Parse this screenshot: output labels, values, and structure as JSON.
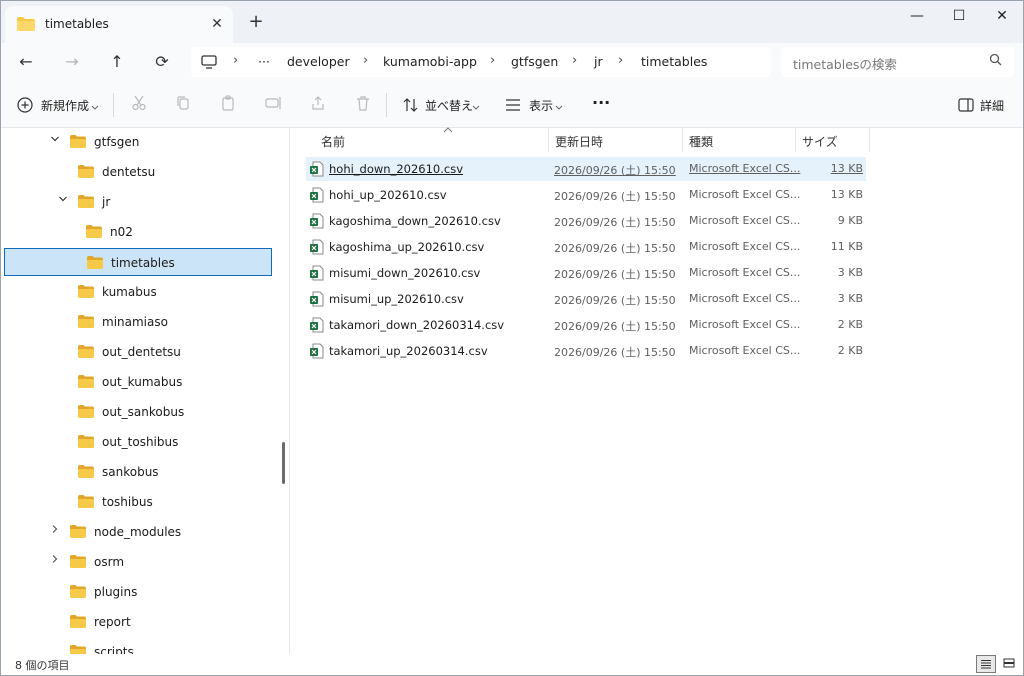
{
  "window": {
    "tab_title": "timetables",
    "tab_close": "✕",
    "new_tab": "+",
    "min": "—",
    "max": "☐",
    "close": "✕"
  },
  "nav": {
    "back": "←",
    "forward": "→",
    "up": "↑",
    "refresh": "⟳",
    "breadcrumb": [
      "developer",
      "kumamobi-app",
      "gtfsgen",
      "jr",
      "timetables"
    ],
    "breadcrumb_sep": "›",
    "overflow": "···",
    "search_placeholder": "timetablesの検索"
  },
  "commands": {
    "new": "新規作成",
    "sort": "並べ替え",
    "view": "表示",
    "more": "···",
    "details": "詳細"
  },
  "sidebar": {
    "items": [
      {
        "label": "gtfsgen",
        "level": 1,
        "chevron": "expanded"
      },
      {
        "label": "dentetsu",
        "level": 2,
        "chevron": "none"
      },
      {
        "label": "jr",
        "level": 2,
        "chevron": "expanded"
      },
      {
        "label": "n02",
        "level": 3,
        "chevron": "none"
      },
      {
        "label": "timetables",
        "level": 3,
        "chevron": "none",
        "selected": true
      },
      {
        "label": "kumabus",
        "level": 2,
        "chevron": "none"
      },
      {
        "label": "minamiaso",
        "level": 2,
        "chevron": "none"
      },
      {
        "label": "out_dentetsu",
        "level": 2,
        "chevron": "none"
      },
      {
        "label": "out_kumabus",
        "level": 2,
        "chevron": "none"
      },
      {
        "label": "out_sankobus",
        "level": 2,
        "chevron": "none"
      },
      {
        "label": "out_toshibus",
        "level": 2,
        "chevron": "none"
      },
      {
        "label": "sankobus",
        "level": 2,
        "chevron": "none"
      },
      {
        "label": "toshibus",
        "level": 2,
        "chevron": "none"
      },
      {
        "label": "node_modules",
        "level": 1,
        "chevron": "collapsed"
      },
      {
        "label": "osrm",
        "level": 1,
        "chevron": "collapsed"
      },
      {
        "label": "plugins",
        "level": 1,
        "chevron": "none"
      },
      {
        "label": "report",
        "level": 1,
        "chevron": "none"
      },
      {
        "label": "scripts",
        "level": 1,
        "chevron": "none"
      }
    ]
  },
  "list": {
    "columns": {
      "name": "名前",
      "date": "更新日時",
      "type": "種類",
      "size": "サイズ"
    },
    "files": [
      {
        "name": "hohi_down_202610.csv",
        "date": "2026/09/26 (土) 15:50",
        "type": "Microsoft Excel CS...",
        "size": "13 KB",
        "hover": true
      },
      {
        "name": "hohi_up_202610.csv",
        "date": "2026/09/26 (土) 15:50",
        "type": "Microsoft Excel CS...",
        "size": "13 KB"
      },
      {
        "name": "kagoshima_down_202610.csv",
        "date": "2026/09/26 (土) 15:50",
        "type": "Microsoft Excel CS...",
        "size": "9 KB"
      },
      {
        "name": "kagoshima_up_202610.csv",
        "date": "2026/09/26 (土) 15:50",
        "type": "Microsoft Excel CS...",
        "size": "11 KB"
      },
      {
        "name": "misumi_down_202610.csv",
        "date": "2026/09/26 (土) 15:50",
        "type": "Microsoft Excel CS...",
        "size": "3 KB"
      },
      {
        "name": "misumi_up_202610.csv",
        "date": "2026/09/26 (土) 15:50",
        "type": "Microsoft Excel CS...",
        "size": "3 KB"
      },
      {
        "name": "takamori_down_20260314.csv",
        "date": "2026/09/26 (土) 15:50",
        "type": "Microsoft Excel CS...",
        "size": "2 KB"
      },
      {
        "name": "takamori_up_20260314.csv",
        "date": "2026/09/26 (土) 15:50",
        "type": "Microsoft Excel CS...",
        "size": "2 KB"
      }
    ]
  },
  "status": {
    "count": "8 個の項目"
  },
  "colors": {
    "folder": "#f7c948",
    "folder_dark": "#e2a72a",
    "accent": "#0f6cbd",
    "selection": "#cce4f7",
    "excel": "#1d6f42"
  }
}
